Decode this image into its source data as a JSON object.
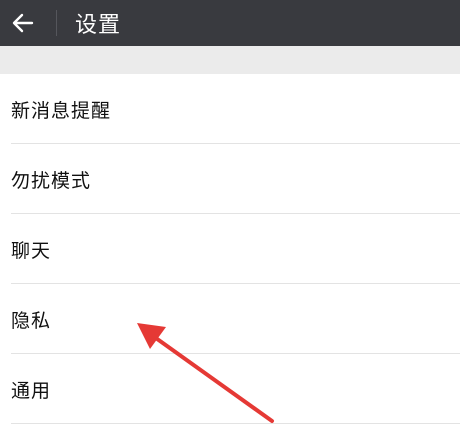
{
  "header": {
    "title": "设置",
    "back_icon": "arrow-left-icon",
    "background": "#393a3f"
  },
  "menu": {
    "items": [
      {
        "label": "新消息提醒"
      },
      {
        "label": "勿扰模式"
      },
      {
        "label": "聊天"
      },
      {
        "label": "隐私"
      },
      {
        "label": "通用"
      }
    ]
  },
  "annotation": {
    "arrow_color": "#e53935",
    "icon": "red-arrow-annotation"
  }
}
